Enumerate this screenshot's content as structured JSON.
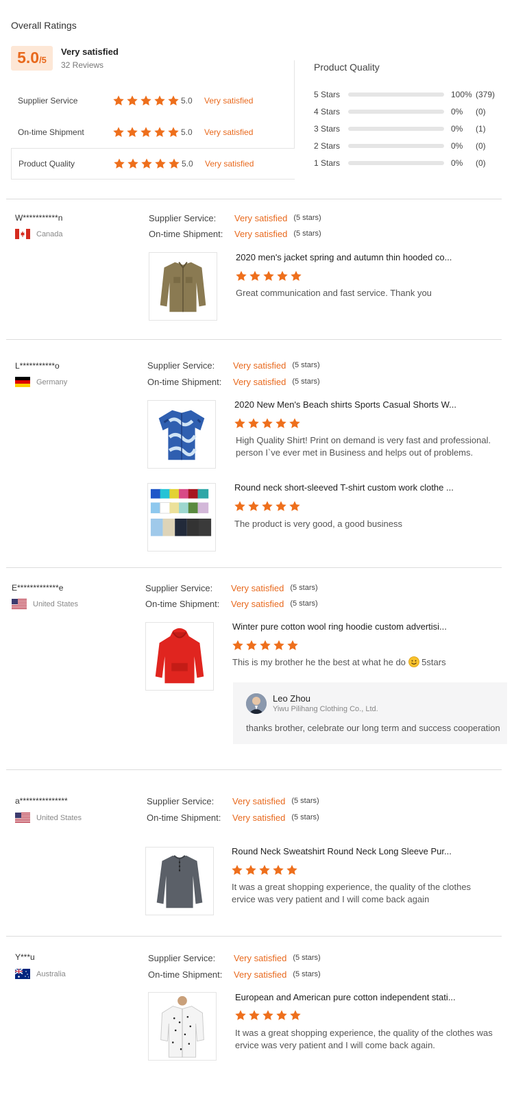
{
  "overall": {
    "title": "Overall Ratings",
    "score": "5.0",
    "score_denominator": "/5",
    "headline": "Very satisfied",
    "reviews_count": "32 Reviews",
    "categories": [
      {
        "name": "Supplier Service",
        "score": "5.0",
        "label": "Very satisfied",
        "rating": 5
      },
      {
        "name": "On-time Shipment",
        "score": "5.0",
        "label": "Very satisfied",
        "rating": 5
      },
      {
        "name": "Product Quality",
        "score": "5.0",
        "label": "Very satisfied",
        "rating": 5,
        "selected": true
      }
    ]
  },
  "breakdown": {
    "title": "Product Quality",
    "rows": [
      {
        "label": "5 Stars",
        "percent": "100%",
        "count": "(379)",
        "fill": 1.0
      },
      {
        "label": "4 Stars",
        "percent": "0%",
        "count": "(0)",
        "fill": 0
      },
      {
        "label": "3 Stars",
        "percent": "0%",
        "count": "(1)",
        "fill": 0
      },
      {
        "label": "2 Stars",
        "percent": "0%",
        "count": "(0)",
        "fill": 0
      },
      {
        "label": "1 Stars",
        "percent": "0%",
        "count": "(0)",
        "fill": 0
      }
    ]
  },
  "labels": {
    "supplier_service": "Supplier Service:",
    "ontime_shipment": "On-time Shipment:",
    "very_satisfied": "Very satisfied",
    "five_stars": "(5 stars)"
  },
  "reviews": [
    {
      "reviewer": "W***********n",
      "country": "Canada",
      "items": [
        {
          "title": "2020 men's jacket spring and autumn thin hooded co...",
          "rating": 5,
          "text": "Great communication and fast service. Thank you",
          "image": "olive-jacket"
        }
      ]
    },
    {
      "reviewer": "L***********o",
      "country": "Germany",
      "items": [
        {
          "title": "2020 New Men's Beach shirts Sports Casual Shorts W...",
          "rating": 5,
          "text": "High Quality Shirt! Print on demand is very fast and professional.",
          "text2": "person I`ve ever met in Business and helps out of problems.",
          "image": "blue-camo-shirt"
        },
        {
          "title": "Round neck short-sleeved T-shirt custom work clothe ...",
          "rating": 5,
          "text": "The product is very good, a good business",
          "image": "tshirt-grid"
        }
      ]
    },
    {
      "reviewer": "E*************e",
      "country": "United States",
      "items": [
        {
          "title": "Winter pure cotton wool ring hoodie custom advertisi...",
          "rating": 5,
          "text": "This is my brother he the best at what he do",
          "text_suffix": "5stars",
          "image": "red-hoodie",
          "emoji": "smiling-face-icon"
        }
      ],
      "reply": {
        "name": "Leo Zhou",
        "company": "Yiwu Pilihang Clothing Co., Ltd.",
        "text": "thanks brother, celebrate our long term and success cooperation"
      }
    },
    {
      "reviewer": "a***************",
      "country": "United States",
      "items": [
        {
          "title": "Round Neck Sweatshirt Round Neck Long Sleeve Pur...",
          "rating": 5,
          "text": "It was a great shopping experience, the quality of the clothes",
          "text2": "ervice was very patient and I will come back again",
          "image": "gray-henley"
        }
      ]
    },
    {
      "reviewer": "Y***u",
      "country": "Australia",
      "items": [
        {
          "title": "European and American pure cotton independent stati...",
          "rating": 5,
          "text": "It was a great shopping experience, the quality of the clothes was",
          "text2": "ervice was very patient and I will come back again.",
          "image": "white-print-shirt"
        }
      ]
    }
  ],
  "colors": {
    "accent": "#e8691d",
    "star": "#ee6f1c",
    "score_bg": "#fde7d6",
    "bar_track": "#e5e5e5",
    "divider": "#dcdcdc",
    "reply_bg": "#f5f5f6"
  }
}
